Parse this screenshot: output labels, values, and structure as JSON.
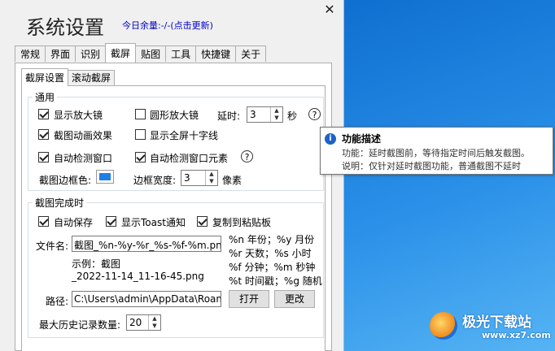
{
  "window": {
    "title": "系统设置",
    "balance_text": "今日余量:-/-(点击更新)",
    "close_glyph": "✕"
  },
  "tabs": [
    {
      "label": "常规"
    },
    {
      "label": "界面"
    },
    {
      "label": "识别"
    },
    {
      "label": "截屏",
      "active": true
    },
    {
      "label": "贴图"
    },
    {
      "label": "工具"
    },
    {
      "label": "快捷键"
    },
    {
      "label": "关于"
    }
  ],
  "subtabs": [
    {
      "label": "截屏设置",
      "active": true
    },
    {
      "label": "滚动截屏"
    }
  ],
  "general": {
    "legend": "通用",
    "show_magnifier": {
      "label": "显示放大镜",
      "checked": true
    },
    "round_magnifier": {
      "label": "圆形放大镜",
      "checked": false
    },
    "delay_label": "延时:",
    "delay_value": "3",
    "delay_unit": "秒",
    "help_glyph": "?",
    "capture_animation": {
      "label": "截图动画效果",
      "checked": true
    },
    "fullscreen_crosshair": {
      "label": "显示全屏十字线",
      "checked": false
    },
    "auto_detect_window": {
      "label": "自动检测窗口",
      "checked": true
    },
    "auto_detect_elements": {
      "label": "自动检测窗口元素",
      "checked": true
    },
    "border_color_label": "截图边框色:",
    "border_color": "#1e7fe6",
    "border_width_label": "边框宽度:",
    "border_width_value": "3",
    "border_width_unit": "像素"
  },
  "after_capture": {
    "legend": "截图完成时",
    "auto_save": {
      "label": "自动保存",
      "checked": true
    },
    "show_toast": {
      "label": "显示Toast通知",
      "checked": true
    },
    "copy_clipboard": {
      "label": "复制到粘贴板",
      "checked": true
    },
    "filename_label": "文件名:",
    "filename_value": "截图_%n-%y-%r_%s-%f-%m.png",
    "example_line1": "示例：截图",
    "example_line2": "_2022-11-14_11-16-45.png",
    "format_help": [
      "%n 年份；%y 月份",
      "%r 天数；%s 小时",
      "%f 分钟；%m 秒钟",
      "%t 时间戳；%g 随机"
    ],
    "path_label": "路径:",
    "path_value": "C:\\Users\\admin\\AppData\\Roaming",
    "open_button": "打开",
    "change_button": "更改",
    "max_history_label": "最大历史记录数量:",
    "max_history_value": "20"
  },
  "tooltip": {
    "icon": "i",
    "title": "功能描述",
    "line1": "功能：延时截图前，等待指定时间后触发截图。",
    "line2": "说明：仅针对延时截图功能，普通截图不延时"
  },
  "watermark": {
    "name": "极光下载站",
    "url": "www.xz7.com"
  }
}
